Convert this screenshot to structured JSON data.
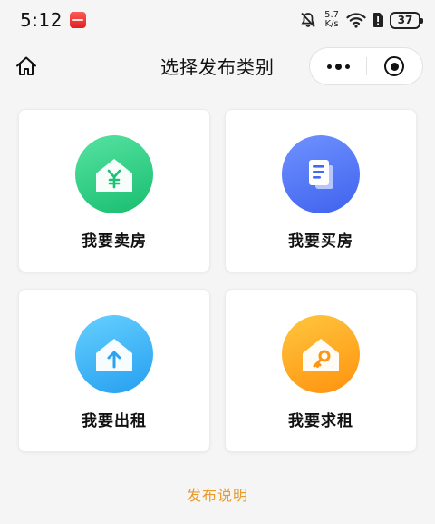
{
  "status_bar": {
    "time": "5:12",
    "net_speed_value": "5.7",
    "net_speed_unit": "K/s",
    "battery": "37"
  },
  "nav": {
    "title": "选择发布类别"
  },
  "cards": [
    {
      "label": "我要卖房",
      "icon": "sell-house-yen-icon",
      "color_from": "#4fdf9a",
      "color_to": "#1cc274"
    },
    {
      "label": "我要买房",
      "icon": "buy-house-document-icon",
      "color_from": "#6a8dff",
      "color_to": "#4468f2"
    },
    {
      "label": "我要出租",
      "icon": "rent-out-house-arrow-icon",
      "color_from": "#5ecbff",
      "color_to": "#2aa4f2"
    },
    {
      "label": "我要求租",
      "icon": "seek-rent-house-key-icon",
      "color_from": "#ffc13a",
      "color_to": "#ff9514"
    }
  ],
  "footer": {
    "publish_info_link": "发布说明"
  }
}
